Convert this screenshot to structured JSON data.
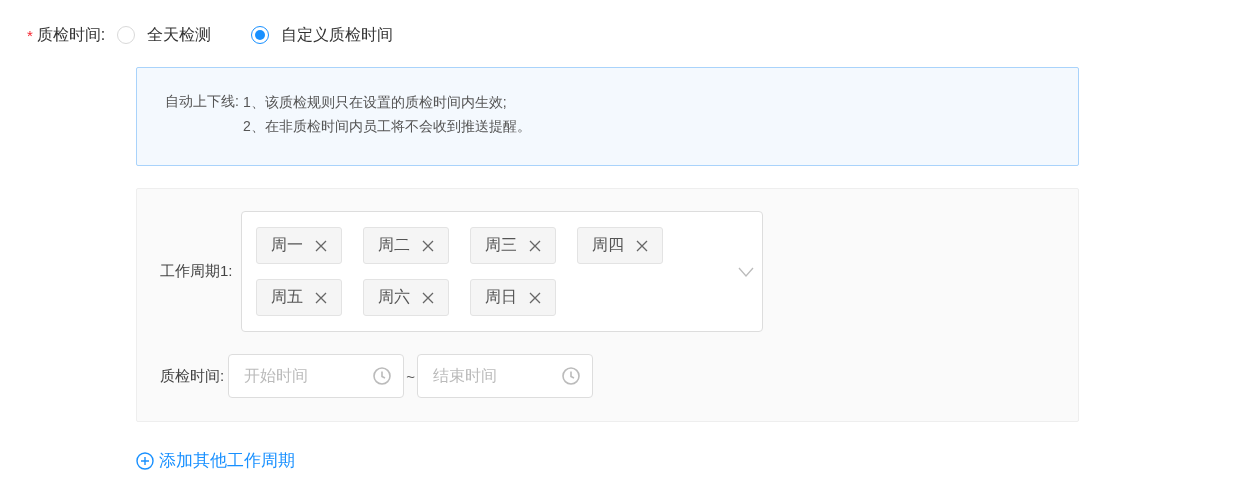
{
  "field": {
    "required_mark": "*",
    "label": "质检时间:"
  },
  "radios": [
    {
      "label": "全天检测",
      "selected": false
    },
    {
      "label": "自定义质检时间",
      "selected": true
    }
  ],
  "notice": {
    "title": "自动上下线:",
    "lines": [
      "1、该质检规则只在设置的质检时间内生效;",
      "2、在非质检时间内员工将不会收到推送提醒。"
    ]
  },
  "periods": [
    {
      "label": "工作周期1:",
      "tags": [
        "周一",
        "周二",
        "周三",
        "周四",
        "周五",
        "周六",
        "周日"
      ],
      "time_label": "质检时间:",
      "start": {
        "placeholder": "开始时间"
      },
      "separator": "~",
      "end": {
        "placeholder": "结束时间"
      }
    }
  ],
  "add_link": "添加其他工作周期"
}
